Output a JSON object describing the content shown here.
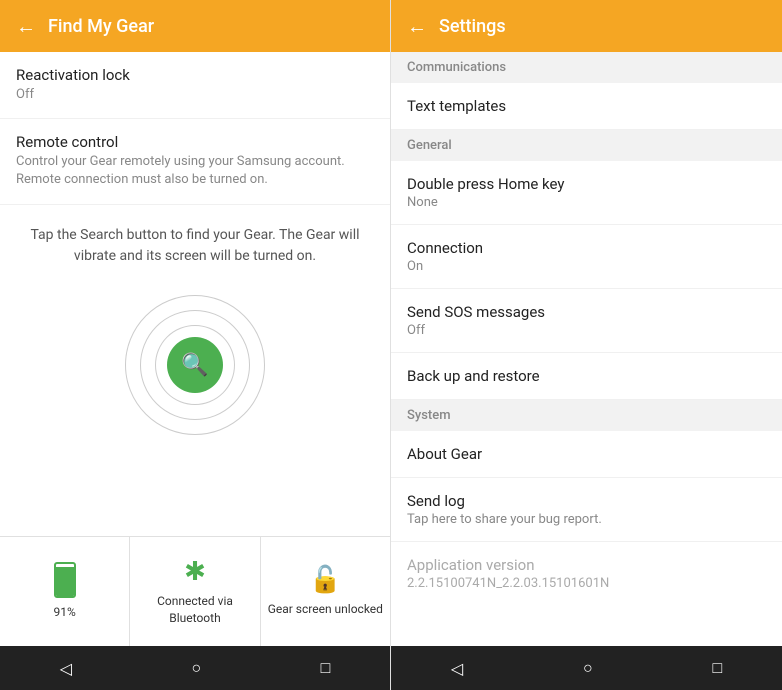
{
  "left": {
    "header": {
      "back_label": "←",
      "title": "Find My Gear"
    },
    "reactivation": {
      "title": "Reactivation lock",
      "sub": "Off"
    },
    "remote_control": {
      "title": "Remote control",
      "sub": "Control your Gear remotely using your Samsung account. Remote connection must also be turned on."
    },
    "search_desc": "Tap the Search button to find your Gear. The Gear will vibrate and its screen will be turned on.",
    "status": {
      "battery_percent": "91%",
      "bluetooth_label": "Connected via Bluetooth",
      "unlock_label": "Gear screen unlocked"
    }
  },
  "right": {
    "header": {
      "back_label": "←",
      "title": "Settings"
    },
    "sections": [
      {
        "section_label": "Communications",
        "items": [
          {
            "title": "Text templates",
            "sub": ""
          }
        ]
      },
      {
        "section_label": "General",
        "items": [
          {
            "title": "Double press Home key",
            "sub": "None"
          },
          {
            "title": "Connection",
            "sub": "On"
          },
          {
            "title": "Send SOS messages",
            "sub": "Off"
          },
          {
            "title": "Back up and restore",
            "sub": ""
          }
        ]
      },
      {
        "section_label": "System",
        "items": [
          {
            "title": "About Gear",
            "sub": ""
          },
          {
            "title": "Send log",
            "sub": "Tap here to share your bug report."
          }
        ]
      }
    ],
    "app_version": {
      "title": "Application version",
      "sub": "2.2.15100741N_2.2.03.15101601N"
    }
  },
  "nav": {
    "back": "◁",
    "home": "○",
    "square": "□"
  }
}
